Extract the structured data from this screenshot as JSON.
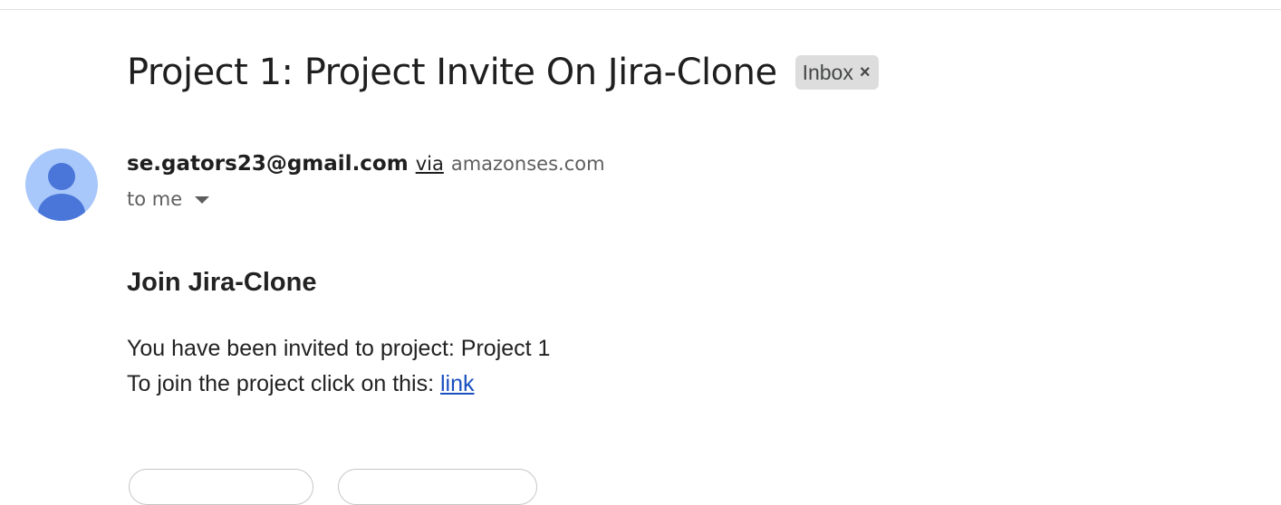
{
  "email": {
    "subject": "Project 1: Project Invite On Jira-Clone",
    "label": {
      "text": "Inbox",
      "close_glyph": "×"
    },
    "sender": {
      "email": "se.gators23@gmail.com",
      "via_label": "via",
      "via_domain": "amazonses.com",
      "avatar_icon": "person-icon",
      "avatar_color": "#a8c7fa"
    },
    "recipient": {
      "label": "to me",
      "caret_icon": "caret-down-icon"
    },
    "body": {
      "heading": "Join Jira-Clone",
      "line1": "You have been invited to project: Project 1",
      "line2_prefix": "To join the project click on this: ",
      "link_text": "link",
      "link_color": "#1a4fbf"
    }
  },
  "actions": {
    "reply_label": "",
    "forward_label": ""
  }
}
